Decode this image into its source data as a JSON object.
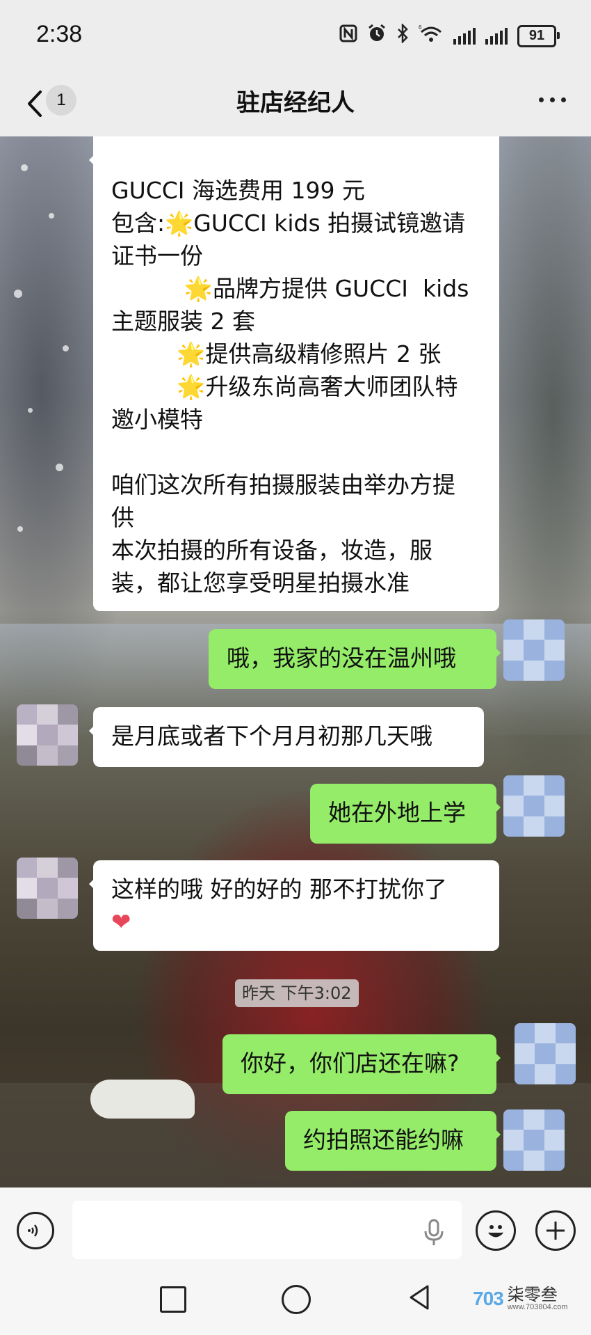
{
  "status_bar": {
    "time": "2:38",
    "battery": "91",
    "icons": [
      "nfc-icon",
      "alarm-icon",
      "bluetooth-icon",
      "wifi-icon",
      "signal-icon",
      "signal-icon",
      "battery-icon"
    ]
  },
  "header": {
    "back_badge": "1",
    "title": "驻店经纪人",
    "more_icon": "more-icon"
  },
  "messages": [
    {
      "side": "in",
      "lines": [
        "GUCCI 海选费用 199 元",
        "包含:🌟GUCCI kids 拍摄试镜邀请",
        "证书一份",
        "          🌟品牌方提供 GUCCI  kids",
        "主题服装 2 套",
        "         🌟提供高级精修照片 2 张",
        "         🌟升级东尚高奢大师团队特",
        "邀小模特",
        "",
        "咱们这次所有拍摄服装由举办方提",
        "供",
        "本次拍摄的所有设备，妆造，服",
        "装，都让您享受明星拍摄水准"
      ]
    },
    {
      "side": "out",
      "text": "哦，我家的没在温州哦"
    },
    {
      "side": "in",
      "text": "是月底或者下个月月初那几天哦"
    },
    {
      "side": "out",
      "text": "她在外地上学"
    },
    {
      "side": "in",
      "text": "这样的哦 好的好的 那不打扰你了",
      "emoji": "❤"
    },
    {
      "side": "out",
      "text": "你好，你们店还在嘛?"
    },
    {
      "side": "out",
      "text": "约拍照还能约嘛"
    }
  ],
  "timestamp": "昨天 下午3:02",
  "input_bar": {
    "voice_icon": "voice-icon",
    "placeholder": "",
    "emoji_icon": "emoji-icon",
    "plus_icon": "plus-icon"
  },
  "watermark": {
    "logo": "703",
    "text": "柒零叁",
    "url": "www.703804.com"
  },
  "colors": {
    "outgoing_bubble": "#95ec69",
    "incoming_bubble": "#ffffff",
    "bar_background": "#ededed"
  }
}
